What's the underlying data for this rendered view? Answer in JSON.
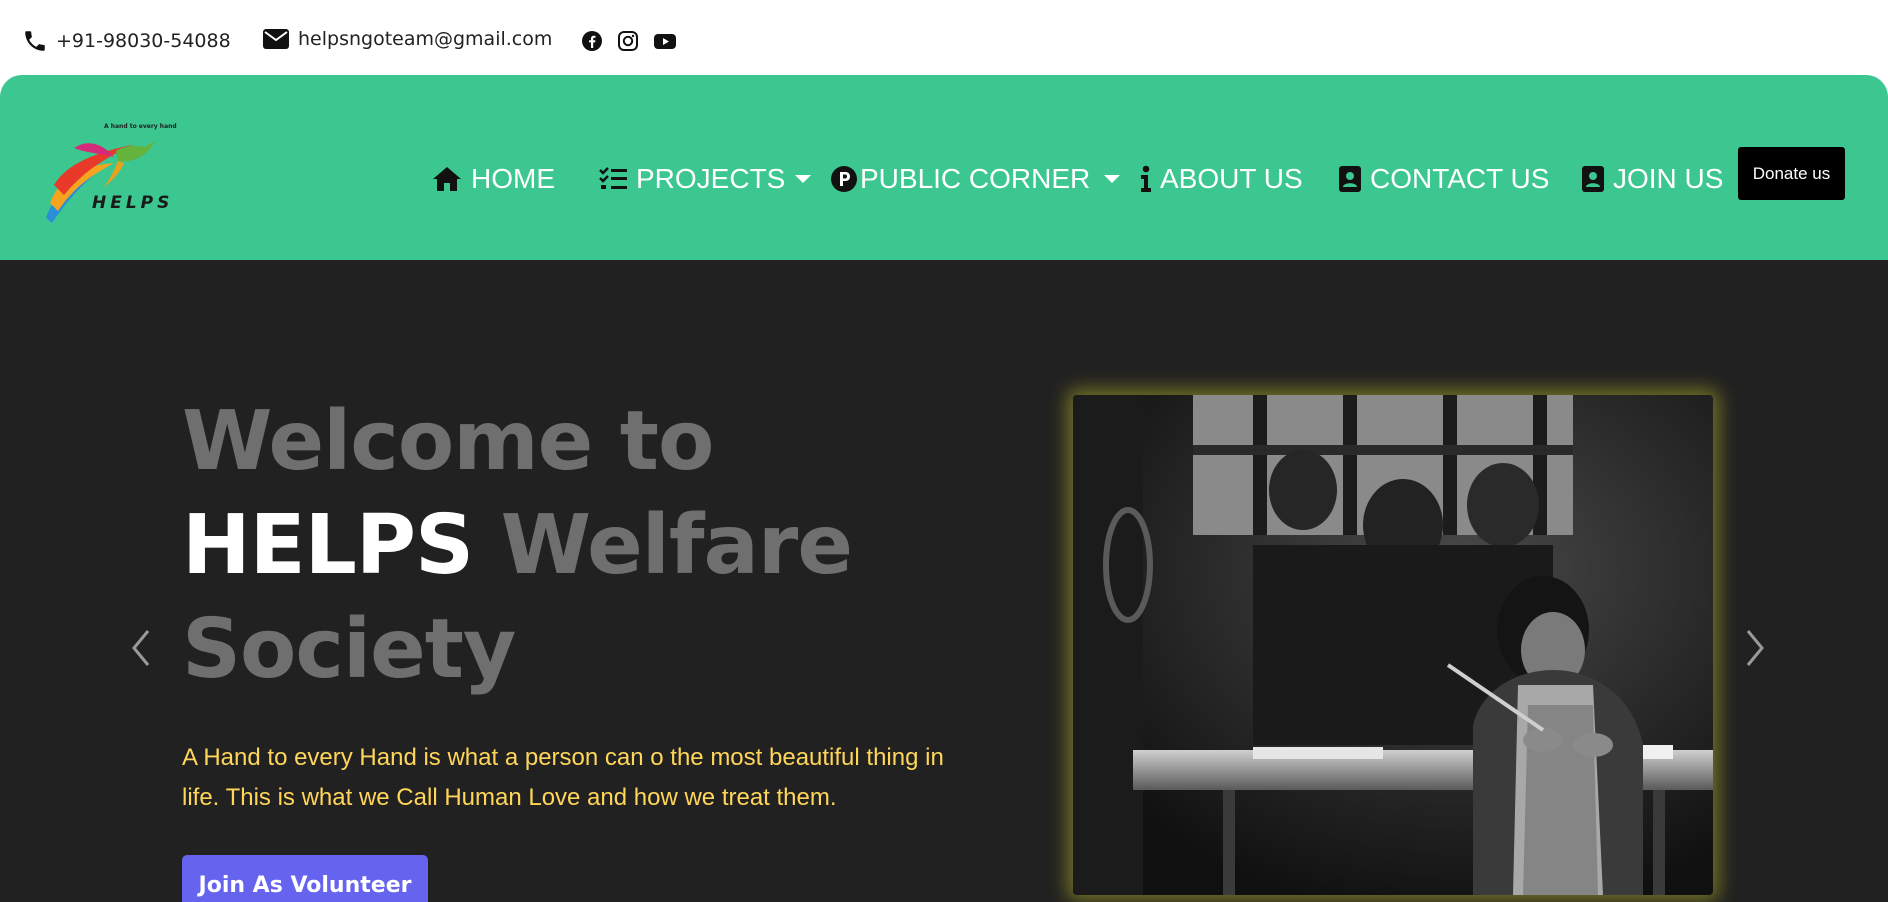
{
  "topbar": {
    "phone": "+91-98030-54088",
    "email": "helpsngoteam@gmail.com",
    "icons": [
      "phone-icon",
      "envelope-icon",
      "facebook-icon",
      "instagram-icon",
      "youtube-icon"
    ]
  },
  "logo": {
    "tagline": "A hand to every hand",
    "name": "HELPS"
  },
  "nav": {
    "items": [
      {
        "label": "HOME",
        "icon": "home-icon"
      },
      {
        "label": "PROJECTS",
        "icon": "list-check-icon",
        "dropdown": true
      },
      {
        "label": "PUBLIC CORNER",
        "icon": "p-circle-icon",
        "dropdown": true
      },
      {
        "label": "ABOUT US",
        "icon": "info-icon"
      },
      {
        "label": "CONTACT US",
        "icon": "contact-book-icon"
      },
      {
        "label": "JOIN US",
        "icon": "contact-book-icon"
      }
    ],
    "donate_label": "Donate us"
  },
  "hero": {
    "title_part1": "Welcome to",
    "title_highlight": "HELPS",
    "title_part2": "Welfare",
    "title_part3": "Society",
    "description": "A Hand to every Hand is what a person can o the most beautiful thing in life. This is what we Call Human Love and how we treat them.",
    "cta_label": "Join As Volunteer"
  },
  "colors": {
    "navbar_bg": "#3cc791",
    "hero_bg": "#212121",
    "hero_title": "#6f6f6f",
    "hero_desc": "#ffd65a",
    "cta_bg": "#6663ee",
    "donate_bg": "#000000"
  }
}
